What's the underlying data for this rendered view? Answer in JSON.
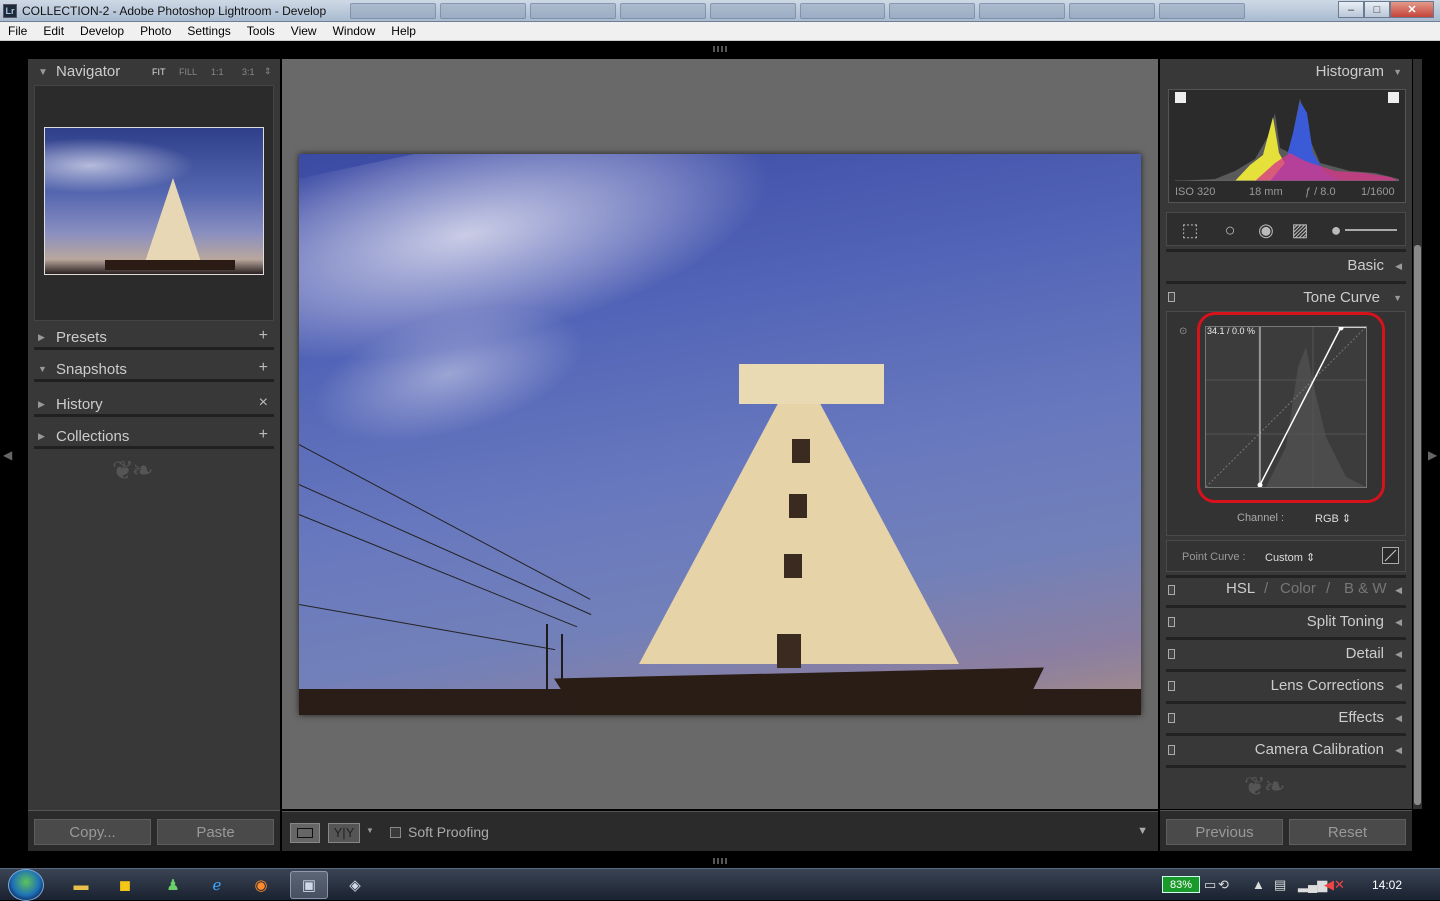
{
  "window": {
    "badge": "Lr",
    "title": "COLLECTION-2 - Adobe Photoshop Lightroom - Develop",
    "controls": {
      "minimize": "–",
      "maximize": "□",
      "close": "✕"
    }
  },
  "menu": [
    "File",
    "Edit",
    "Develop",
    "Photo",
    "Settings",
    "Tools",
    "View",
    "Window",
    "Help"
  ],
  "left_panel": {
    "navigator": {
      "label": "Navigator",
      "zoom": [
        "FIT",
        "FILL",
        "1:1",
        "3:1"
      ],
      "zoom_more": "⇕"
    },
    "sections": [
      {
        "label": "Presets",
        "action": "+",
        "expanded": false
      },
      {
        "label": "Snapshots",
        "action": "+",
        "expanded": true
      },
      {
        "label": "History",
        "action": "×",
        "expanded": false
      },
      {
        "label": "Collections",
        "action": "+",
        "expanded": false
      }
    ],
    "copy_label": "Copy...",
    "paste_label": "Paste"
  },
  "toolbar": {
    "soft_proofing": "Soft Proofing",
    "compare_label": "Y|Y"
  },
  "right_panel": {
    "histogram": {
      "label": "Histogram",
      "iso": "ISO 320",
      "focal": "18 mm",
      "aperture": "ƒ / 8.0",
      "shutter": "1/1600"
    },
    "basic": "Basic",
    "tone_curve": {
      "label": "Tone Curve",
      "readout": "34.1 / 0.0 %",
      "channel_label": "Channel :",
      "channel_value": "RGB ⇕",
      "point_curve_label": "Point Curve :",
      "point_curve_value": "Custom ⇕"
    },
    "hsl": {
      "hsl": "HSL",
      "sep": "/",
      "color": "Color",
      "bw": "B & W"
    },
    "sections": [
      "Split Toning",
      "Detail",
      "Lens Corrections",
      "Effects",
      "Camera Calibration"
    ],
    "previous_label": "Previous",
    "reset_label": "Reset"
  },
  "taskbar": {
    "battery": "83%",
    "clock": "14:02"
  },
  "colors": {
    "highlight_ring": "#d6121b",
    "panel": "#383838",
    "canvas": "#696969"
  }
}
